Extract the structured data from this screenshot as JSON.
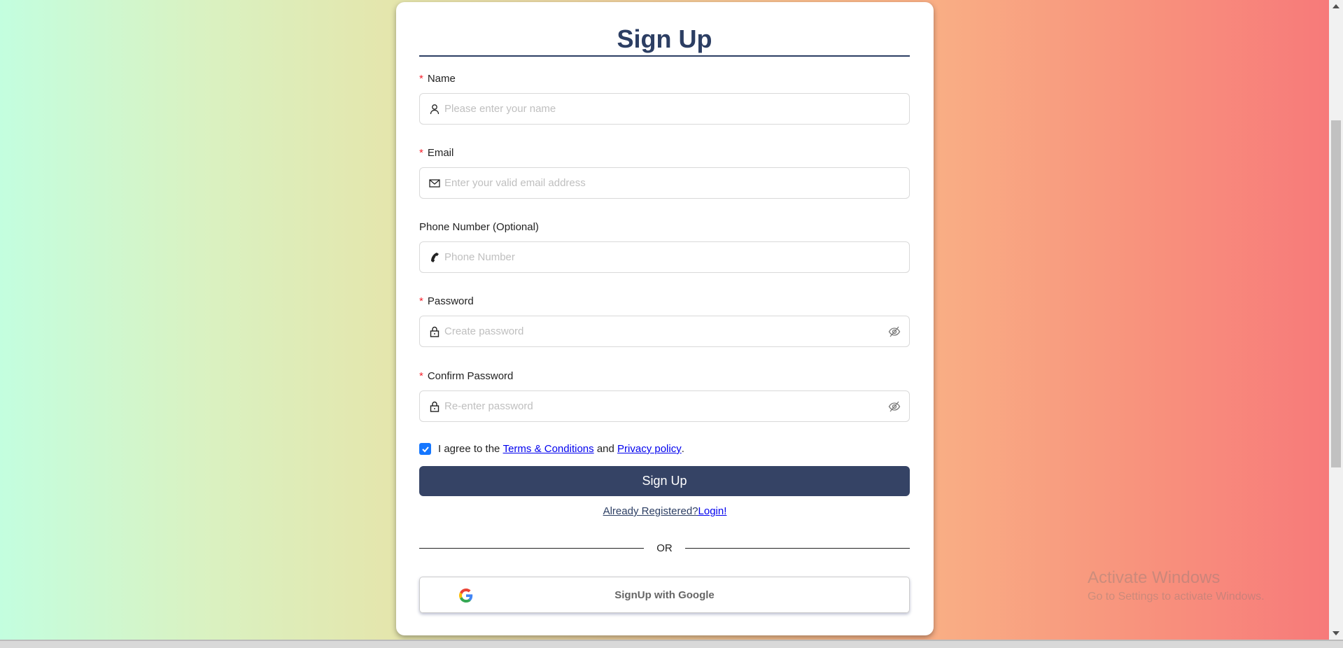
{
  "form": {
    "title": "Sign Up",
    "fields": [
      {
        "label": "Name",
        "required": true,
        "placeholder": "Please enter your name",
        "icon": "user-icon"
      },
      {
        "label": "Email",
        "required": true,
        "placeholder": "Enter your valid email address",
        "icon": "mail-icon"
      },
      {
        "label": "Phone Number (Optional)",
        "required": false,
        "placeholder": "Phone Number",
        "icon": "phone-icon"
      },
      {
        "label": "Password",
        "required": true,
        "placeholder": "Create password",
        "icon": "lock-icon"
      },
      {
        "label": "Confirm Password",
        "required": true,
        "placeholder": "Re-enter password",
        "icon": "lock-icon"
      }
    ],
    "required_mark": "*",
    "agree": {
      "checked": true,
      "prefix": "I agree to the",
      "terms": "Terms & Conditions",
      "and": "and",
      "privacy": "Privacy policy",
      "suffix": "."
    },
    "submit_label": "Sign Up",
    "login_prompt": "Already Registered?",
    "login_link": "Login!",
    "or_label": "OR",
    "google_label": "SignUp with Google"
  },
  "watermark": {
    "line1": "Activate Windows",
    "line2": "Go to Settings to activate Windows."
  },
  "colors": {
    "primary": "#354365",
    "title": "#2c3e63",
    "checkbox": "#1677ff",
    "required": "#f5222d"
  }
}
